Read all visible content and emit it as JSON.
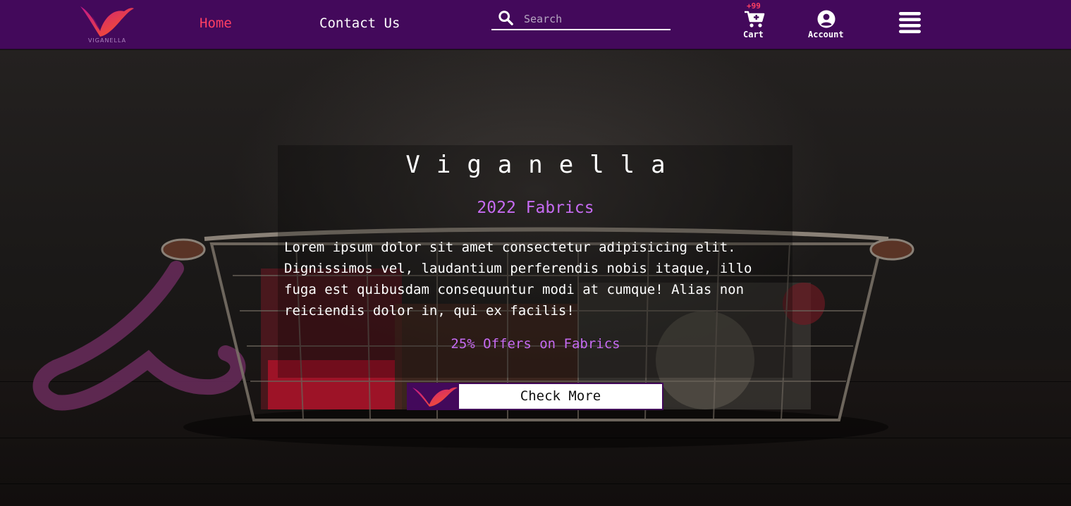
{
  "brand": {
    "logo_icon": "viganella-bird-logo",
    "colors": {
      "navbar": "#43095b",
      "active_link": "#ff3f63",
      "accent": "#c66bf2",
      "logo_gradient_start": "#ff5a1f",
      "logo_gradient_end": "#c2178a"
    }
  },
  "nav": {
    "links": [
      {
        "label": "Home",
        "active": true
      },
      {
        "label": "Contact Us",
        "active": false
      }
    ],
    "search": {
      "placeholder": "Search",
      "value": "",
      "icon": "search-icon"
    },
    "cart": {
      "badge": "+99",
      "label": "Cart",
      "icon": "cart-icon"
    },
    "account": {
      "label": "Account",
      "icon": "user-circle-icon"
    },
    "menu": {
      "icon": "hamburger-menu-icon"
    }
  },
  "hero": {
    "title": "Viganella",
    "subtitle": "2022 Fabrics",
    "text": "Lorem ipsum dolor sit amet consectetur adipisicing elit. Dignissimos vel, laudantium perferendis nobis itaque, illo fuga est quibusdam consequuntur modi at cumque! Alias non reiciendis dolor in, qui ex facilis!",
    "offer": "25% Offers on Fabrics",
    "button_label": "Check More",
    "button_icon": "viganella-bird-logo",
    "background": "wire basket of fabrics and thread on a dark wooden table"
  }
}
